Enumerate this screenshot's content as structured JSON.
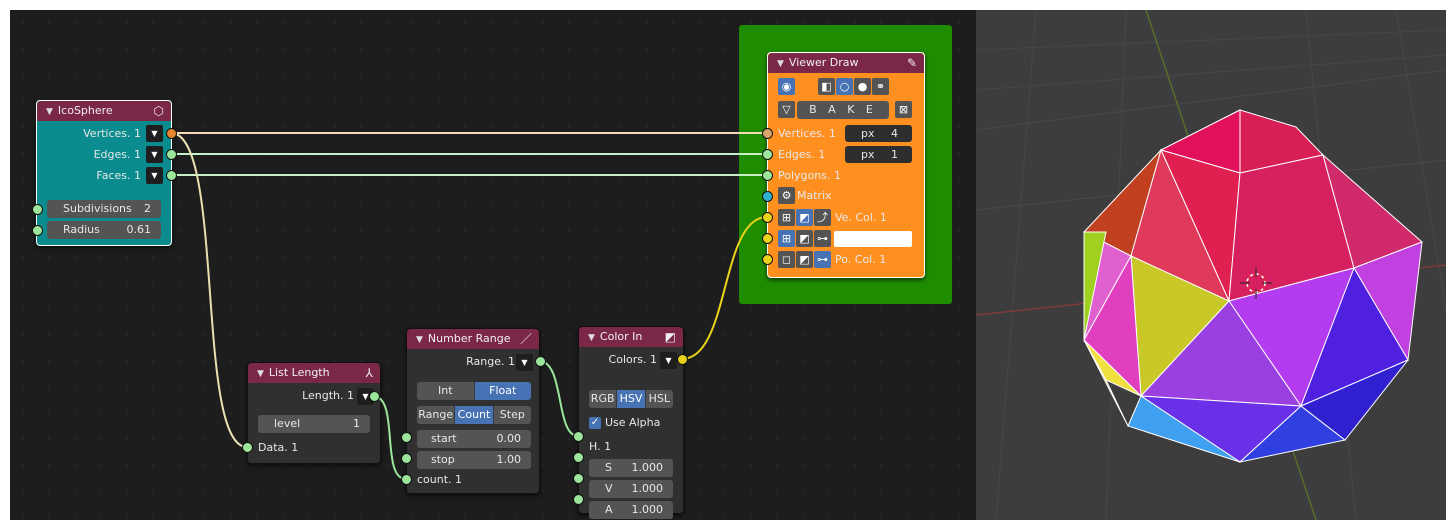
{
  "nodes": {
    "icosphere": {
      "title": "IcoSphere",
      "outputs": [
        "Vertices. 1",
        "Edges. 1",
        "Faces. 1"
      ],
      "subdivisions": {
        "label": "Subdivisions",
        "value": "2"
      },
      "radius": {
        "label": "Radius",
        "value": "0.61"
      }
    },
    "list_length": {
      "title": "List Length",
      "output": "Length. 1",
      "level": {
        "label": "level",
        "value": "1"
      },
      "input": "Data. 1"
    },
    "number_range": {
      "title": "Number Range",
      "output": "Range. 1",
      "mode_a": [
        "Int",
        "Float"
      ],
      "mode_a_selected": "Float",
      "mode_b": [
        "Range",
        "Count",
        "Step"
      ],
      "mode_b_selected": "Count",
      "start": {
        "label": "start",
        "value": "0.00"
      },
      "stop": {
        "label": "stop",
        "value": "1.00"
      },
      "count": "count. 1"
    },
    "color_in": {
      "title": "Color In",
      "output": "Colors. 1",
      "modes": [
        "RGB",
        "HSV",
        "HSL"
      ],
      "mode_selected": "HSV",
      "use_alpha": "Use Alpha",
      "h": "H. 1",
      "s": {
        "label": "S",
        "value": "1.000"
      },
      "v": {
        "label": "V",
        "value": "1.000"
      },
      "a": {
        "label": "A",
        "value": "1.000"
      }
    },
    "viewer_draw": {
      "title": "Viewer Draw",
      "bake_label": "B A K E",
      "inputs": {
        "vertices": "Vertices. 1",
        "edges": "Edges. 1",
        "polygons": "Polygons. 1",
        "matrix": "Matrix",
        "ve_col": "Ve. Col. 1",
        "po_col": "Po. Col. 1"
      },
      "vertex_size": {
        "unit": "px",
        "value": "4"
      },
      "edge_width": {
        "unit": "px",
        "value": "1"
      }
    }
  },
  "colors": {
    "frame_green": "#1f8c00",
    "viewer_orange": "#ff8f1f",
    "icosphere_teal": "#0a8c8e",
    "header_red": "#7b2747",
    "accent_blue": "#4772b3"
  }
}
